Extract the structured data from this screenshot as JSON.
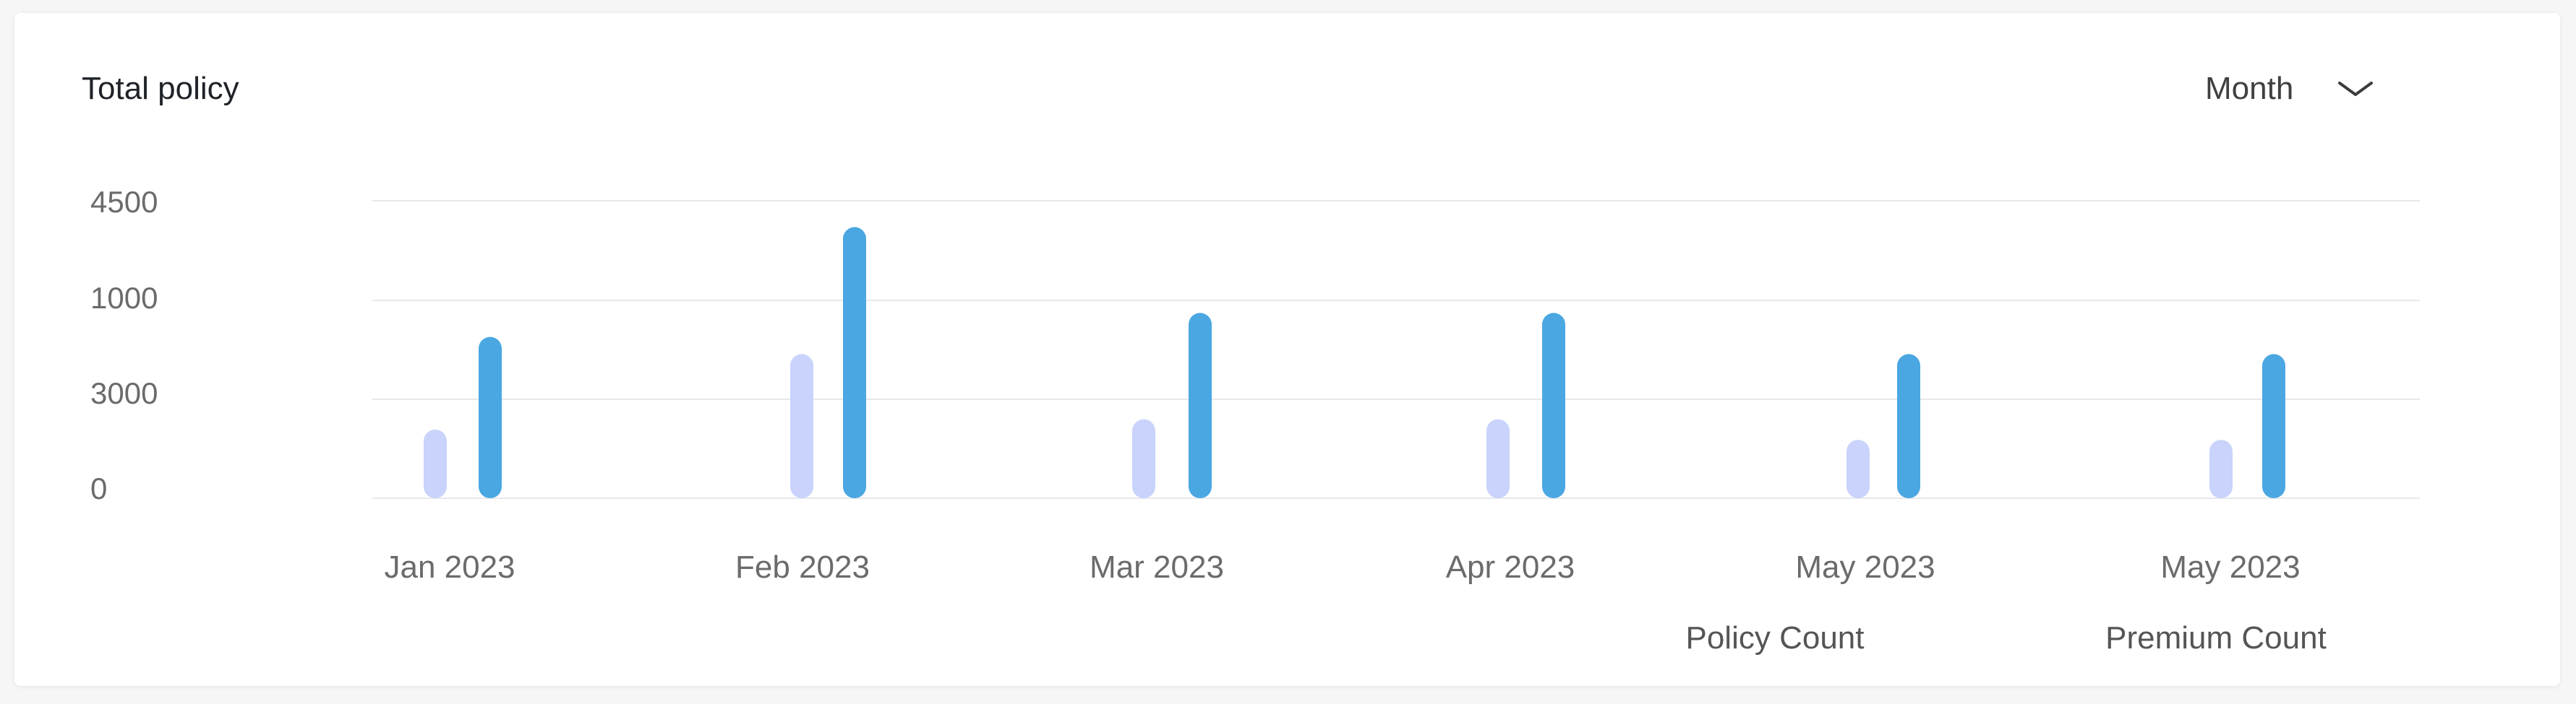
{
  "card": {
    "title": "Total policy",
    "period_select": {
      "selected": "Month",
      "icon": "chevron-down-icon"
    }
  },
  "chart_data": {
    "type": "bar",
    "categories": [
      "Jan 2023",
      "Feb 2023",
      "Mar 2023",
      "Apr 2023",
      "May 2023",
      "May 2023"
    ],
    "y_tick_labels": [
      "0",
      "3000",
      "1000",
      "4500"
    ],
    "series": [
      {
        "name": "Policy Count",
        "color": "#c9d3fb",
        "values": [
          1000,
          2100,
          1150,
          1150,
          850,
          850
        ]
      },
      {
        "name": "Premium Count",
        "color": "#4aa7e2",
        "values": [
          2350,
          3950,
          2700,
          2700,
          2100,
          2100
        ]
      }
    ],
    "ylim": [
      0,
      4650
    ],
    "grid": true,
    "legend": "bottom-right"
  }
}
